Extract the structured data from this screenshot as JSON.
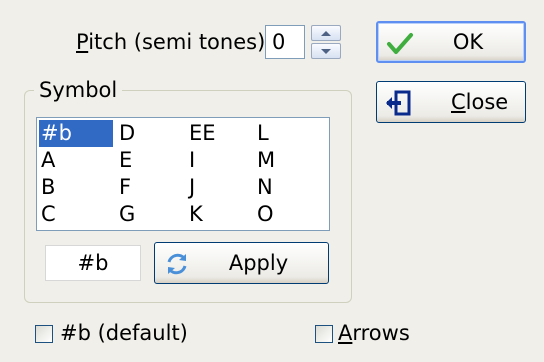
{
  "pitch": {
    "label_prefix": "",
    "label_mnemonic": "P",
    "label_rest": "itch (semi tones) :",
    "value": "0"
  },
  "buttons": {
    "ok": "OK",
    "close_mnemonic": "C",
    "close_rest": "lose",
    "apply": "Apply"
  },
  "symbol_group": {
    "legend": "Symbol",
    "columns": [
      [
        "#b",
        "A",
        "B",
        "C"
      ],
      [
        "D",
        "E",
        "F",
        "G"
      ],
      [
        "EE",
        "I",
        "J",
        "K"
      ],
      [
        "L",
        "M",
        "N",
        "O"
      ]
    ],
    "selected": "#b",
    "current_value": "#b"
  },
  "checkboxes": {
    "default_label": "#b (default)",
    "default_checked": false,
    "arrows_mnemonic": "A",
    "arrows_rest": "rrows",
    "arrows_checked": false
  },
  "icons": {
    "ok": "check-icon",
    "close": "exit-door-icon",
    "apply": "refresh-icon"
  },
  "colors": {
    "selection": "#316ac5",
    "ok_check": "#3fae3f",
    "close_icon": "#0a2a8c",
    "apply_icon": "#4a90d9"
  }
}
